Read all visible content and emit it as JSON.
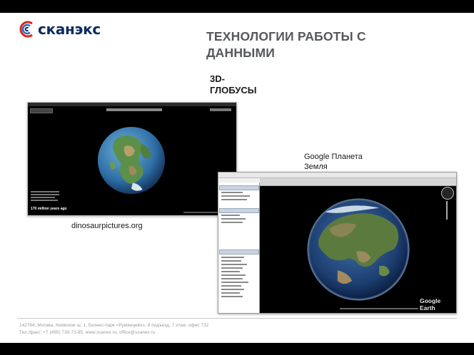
{
  "brand": {
    "name": "сканэкс",
    "colors": {
      "dark_blue": "#0d2b5e",
      "accent_red": "#e2231a",
      "accent_blue": "#2a6fb8"
    }
  },
  "slide": {
    "title": "ТЕХНОЛОГИИ РАБОТЫ С ДАННЫМИ",
    "subtitle": "3D-ГЛОБУСЫ"
  },
  "figures": [
    {
      "caption": "dinosaurpictures.org",
      "era_label": "170 million years ago"
    },
    {
      "caption": "Google Планета Земля",
      "brand_mark": "Google Earth"
    }
  ],
  "footer": {
    "address": "142784, Москва, Киевское ш. 1, Бизнес-парк «Румянцево», 8 подъезд, 7 этаж, офис 732",
    "contacts": "Тел./факс: +7 (495) 739-73-85, www.scanex.ru, office@scanex.ru"
  }
}
